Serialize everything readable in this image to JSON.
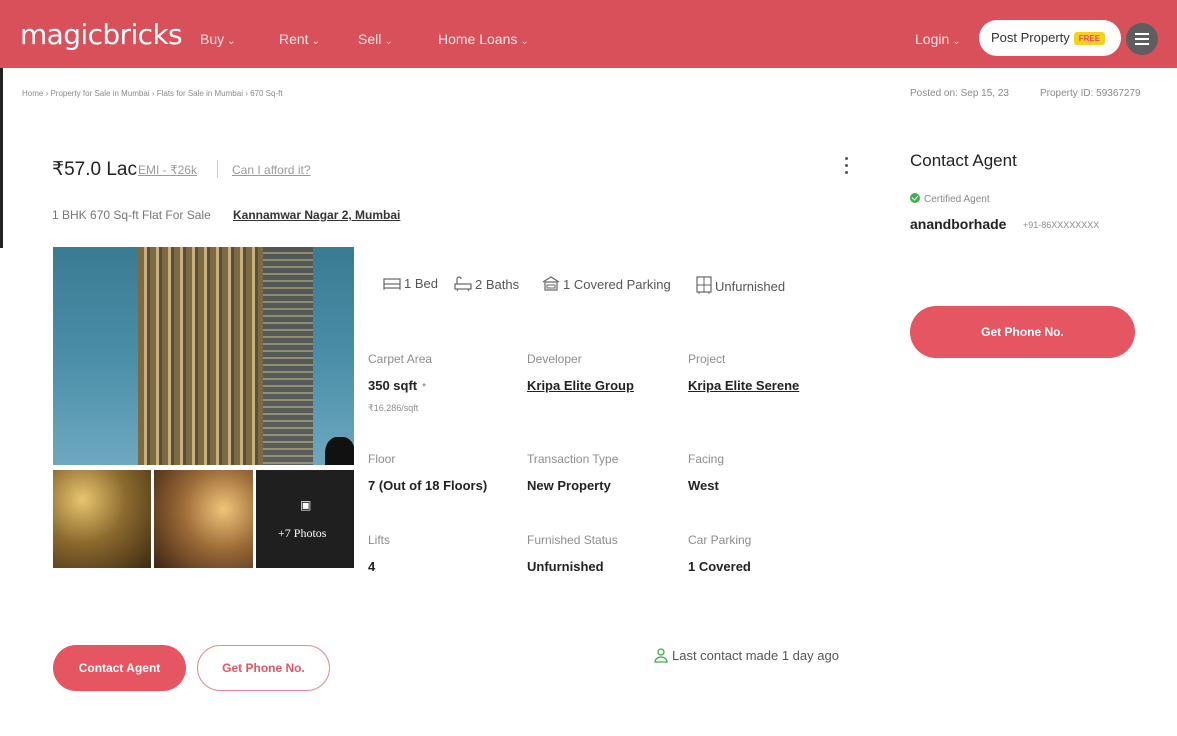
{
  "header": {
    "logo": "magicbricks",
    "nav": [
      {
        "label": "Buy"
      },
      {
        "label": "Rent"
      },
      {
        "label": "Sell"
      },
      {
        "label": "Home Loans"
      }
    ],
    "login_label": "Login",
    "post_property_label": "Post Property",
    "free_badge": "FREE"
  },
  "breadcrumb": "Home › Property for Sale in Mumbai › Flats for Sale in Mumbai › 670 Sq-ft",
  "posted_on": "Posted on: Sep 15, 23",
  "property_id": "Property ID: 59367279",
  "listing": {
    "price": "₹57.0 Lac",
    "emi": "EMI - ₹26k",
    "afford": "Can I afford it?",
    "subtitle": "1 BHK 670 Sq-ft Flat For Sale",
    "locality": "Kannamwar Nagar 2, Mumbai",
    "more_photos": "+7 Photos",
    "features": {
      "bed": "1 Bed",
      "baths": "2 Baths",
      "parking": "1 Covered Parking",
      "furnishing": "Unfurnished"
    },
    "details": {
      "carpet_area_label": "Carpet Area",
      "carpet_area_value": "350 sqft",
      "carpet_area_rate": "₹16,286/sqft",
      "developer_label": "Developer",
      "developer_value": "Kripa Elite Group",
      "project_label": "Project",
      "project_value": "Kripa Elite Serene",
      "floor_label": "Floor",
      "floor_value": "7 (Out of 18 Floors)",
      "transaction_label": "Transaction Type",
      "transaction_value": "New Property",
      "facing_label": "Facing",
      "facing_value": "West",
      "lifts_label": "Lifts",
      "lifts_value": "4",
      "furnished_label": "Furnished Status",
      "furnished_value": "Unfurnished",
      "car_parking_label": "Car Parking",
      "car_parking_value": "1 Covered"
    }
  },
  "actions": {
    "contact_agent": "Contact Agent",
    "get_phone": "Get Phone No.",
    "last_contact": "Last contact made 1 day ago"
  },
  "agent_panel": {
    "title": "Contact Agent",
    "certified": "Certified Agent",
    "name": "anandborhade",
    "phone": "+91-86XXXXXXXX",
    "get_phone": "Get Phone No."
  },
  "colors": {
    "brand": "#d8505a",
    "button": "#e65562"
  }
}
